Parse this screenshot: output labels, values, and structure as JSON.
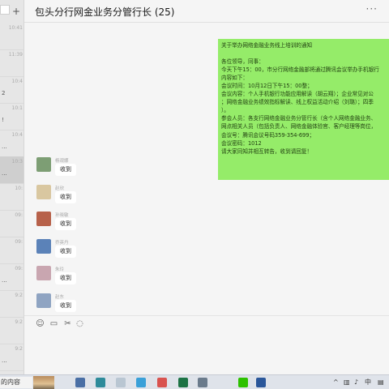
{
  "window": {
    "title": "包头分行网金业务分管行长 (25)",
    "more_icon": "more-horizontal-icon"
  },
  "left_strip": {
    "search_icon": "search-icon",
    "add_icon": "plus-icon",
    "rows": [
      {
        "time": "10:41",
        "snippet": ""
      },
      {
        "time": "11:39",
        "snippet": ""
      },
      {
        "time": "10:4",
        "snippet": "2"
      },
      {
        "time": "10:1",
        "snippet": "!"
      },
      {
        "time": "10:4",
        "snippet": "..."
      },
      {
        "time": "10:3",
        "snippet": "..."
      },
      {
        "time": "10:",
        "snippet": ""
      },
      {
        "time": "09:",
        "snippet": ""
      },
      {
        "time": "09:",
        "snippet": ""
      },
      {
        "time": "09:",
        "snippet": "..."
      },
      {
        "time": "9:2",
        "snippet": ""
      },
      {
        "time": "9:2",
        "snippet": ""
      },
      {
        "time": "9:2",
        "snippet": "..."
      }
    ]
  },
  "messages": {
    "outgoing": {
      "lines": [
        "关于举办网络金融业务线上培训的通知",
        "",
        "各位领导，同事：",
        "今天下午15：00，市分行网络金融部将通过腾讯会议举办手机银行",
        "内容如下：",
        "会议时间：10月12日下午15：00整；",
        "会议内容：个人手机银行功能应用解读（胡云翔）；企业常见对公",
        "；网络金融业务绩效指标解读、线上权益活动介绍（刘璐）；四季",
        "）。",
        "参会人员：各支行网络金融业务分管行长（含个人网络金融业务、",
        "网点相关人员（包括负责人、网络金融体验官、客户经理等岗位，",
        "会议号：腾讯会议号码359-354-699；",
        "会议密码：1012",
        "请大家同知并相互转告，收到请回复！"
      ]
    },
    "incoming": [
      {
        "sender": "杨观娜",
        "text": "收到",
        "avatar_color": "#7d9e74"
      },
      {
        "sender": "赵欣",
        "text": "收到",
        "avatar_color": "#d9c7a0"
      },
      {
        "sender": "孙晓敏",
        "text": "收到",
        "avatar_color": "#b7614a"
      },
      {
        "sender": "乔英丹",
        "text": "收到",
        "avatar_color": "#5b82b8"
      },
      {
        "sender": "朱玲",
        "text": "收到",
        "avatar_color": "#c9a6b0"
      },
      {
        "sender": "赵东",
        "text": "收到",
        "avatar_color": "#8fa4c2"
      }
    ]
  },
  "toolbar": {
    "icons": [
      "emoji-icon",
      "folder-icon",
      "scissors-icon",
      "chat-bubble-icon"
    ]
  },
  "taskbar": {
    "search_text": "的内容",
    "apps": [
      {
        "icon": "calculator-icon",
        "color": "#4a6fa5"
      },
      {
        "icon": "photos-icon",
        "color": "#2e8b9a"
      },
      {
        "icon": "paint-icon",
        "color": "#b9c6d2"
      },
      {
        "icon": "store-icon",
        "color": "#3aa0d8"
      },
      {
        "icon": "media-icon",
        "color": "#d9534f"
      },
      {
        "icon": "excel-icon",
        "color": "#1d7345"
      },
      {
        "icon": "settings-icon",
        "color": "#6b7b8c"
      },
      {
        "icon": "wechat-icon",
        "color": "#2dc100"
      },
      {
        "icon": "word-icon",
        "color": "#2b579a"
      }
    ],
    "tray_icons": [
      "chevron-up-icon",
      "network-icon",
      "volume-icon",
      "ime-icon",
      "notification-icon"
    ]
  },
  "colors": {
    "outgoing_bubble": "#95ec69",
    "incoming_bubble": "#ffffff",
    "chat_background": "#f5f5f5"
  }
}
